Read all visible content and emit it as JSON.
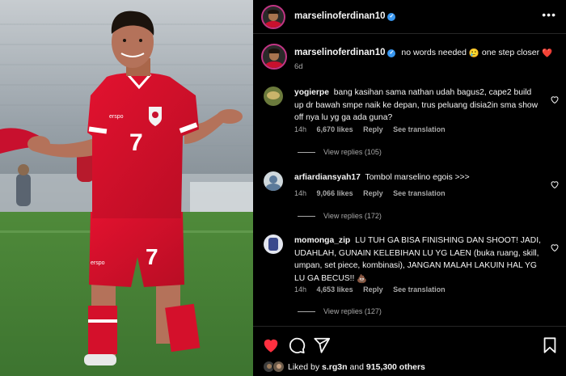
{
  "post": {
    "username": "marselinoferdinan10",
    "caption": "no words needed",
    "caption_emoji_1": "🥲",
    "caption_tail": "one step closer",
    "caption_heart": "❤️",
    "time": "6d",
    "player_number": "7",
    "sponsor": "erspo"
  },
  "comments": [
    {
      "username": "yogierpe",
      "text": "bang kasihan sama nathan udah bagus2, cape2 build up dr bawah smpe naik ke depan, trus peluang disia2in sma show off nya lu yg ga ada guna?",
      "time": "14h",
      "likes": "6,670 likes",
      "reply": "Reply",
      "translate": "See translation",
      "replies": "View replies (105)",
      "avatar_color": "#6b7a3c"
    },
    {
      "username": "arfiardiansyah17",
      "text": "Tombol marselino egois >>>",
      "time": "14h",
      "likes": "9,066 likes",
      "reply": "Reply",
      "translate": "See translation",
      "replies": "View replies (172)",
      "avatar_color": "#cfd8dc"
    },
    {
      "username": "momonga_zip",
      "text": "LU TUH GA BISA FINISHING DAN SHOOT! JADI, UDAHLAH, GUNAIN KELEBIHAN LU YG LAEN (buka ruang, skill, umpan, set piece, kombinasi), JANGAN MALAH LAKUIN HAL YG LU GA BECUS!!",
      "emoji": "💩",
      "time": "14h",
      "likes": "4,653 likes",
      "reply": "Reply",
      "translate": "See translation",
      "replies": "View replies (127)",
      "avatar_color": "#e3e6ef"
    }
  ],
  "likes_bar": {
    "prefix": "Liked by",
    "liker": "s.rg3n",
    "conj": "and",
    "others": "915,300 others"
  },
  "icons": {
    "more": "more-options-icon",
    "like": "heart-filled-icon",
    "comment": "comment-icon",
    "share": "share-icon",
    "save": "bookmark-icon"
  },
  "colors": {
    "like_red": "#ff3040",
    "verified_blue": "#3897f0",
    "secondary_text": "#a8a8a8",
    "jersey_red": "#c8102e"
  }
}
